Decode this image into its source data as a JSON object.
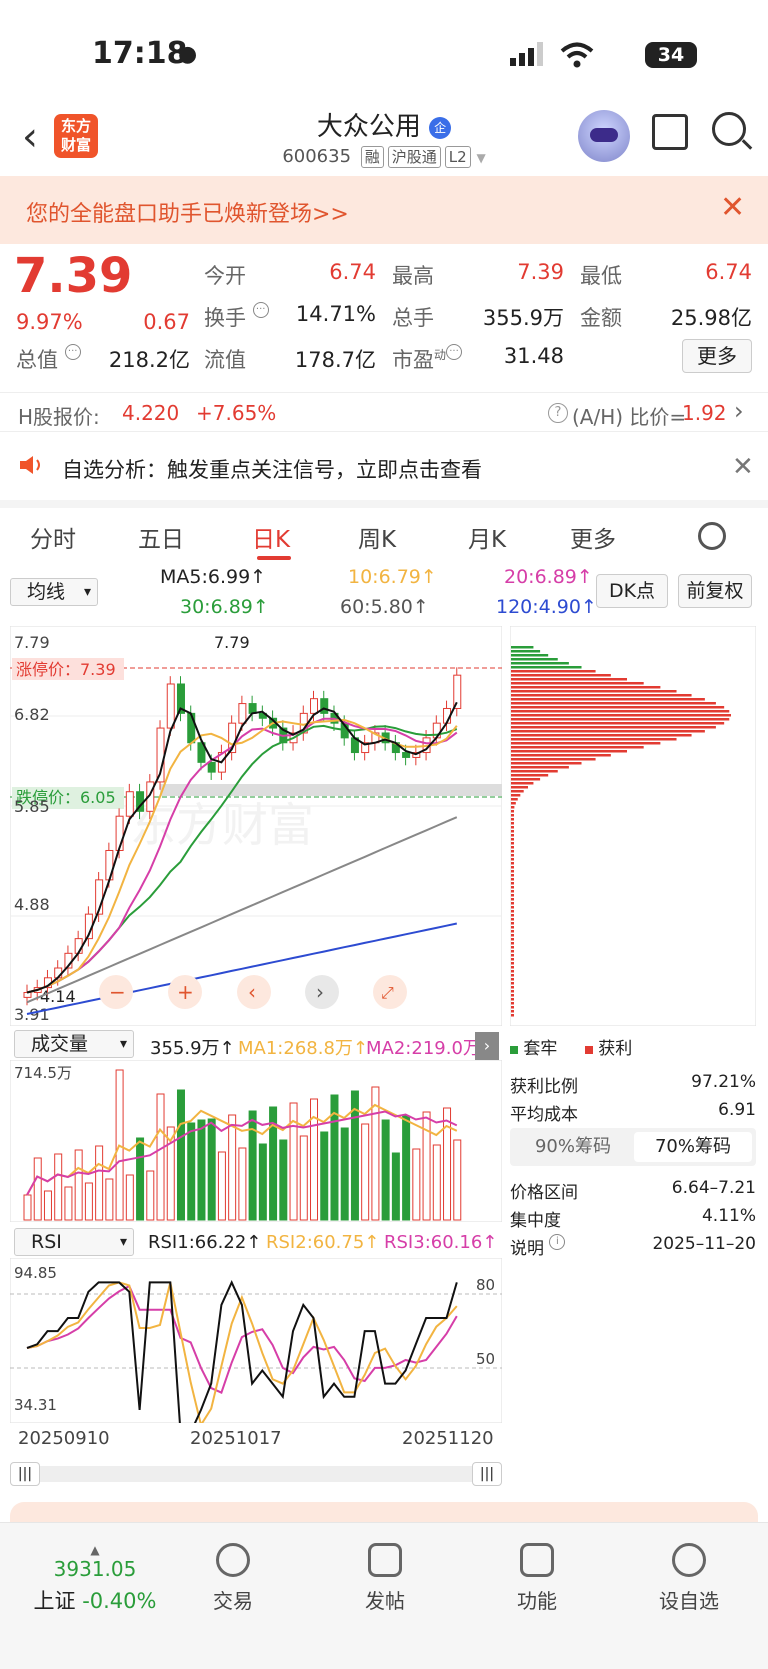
{
  "status": {
    "time": "17:18",
    "battery": "34"
  },
  "header": {
    "name": "大众公用",
    "qi": "企",
    "code": "600635",
    "tags": [
      "融",
      "沪股通",
      "L2"
    ],
    "logo": "东方财富"
  },
  "banner": {
    "text": "您的全能盘口助手已焕新登场>>"
  },
  "quote": {
    "price": "7.39",
    "change_pct": "9.97%",
    "change": "0.67",
    "open_label": "今开",
    "open": "6.74",
    "high_label": "最高",
    "high": "7.39",
    "low_label": "最低",
    "low": "6.74",
    "turnover_label": "换手",
    "turnover": "14.71%",
    "volume_label": "总手",
    "volume": "355.9万",
    "amount_label": "金额",
    "amount": "25.98亿",
    "mktcap_label": "总值",
    "mktcap": "218.2亿",
    "float_label": "流值",
    "float": "178.7亿",
    "pe_label": "市盈",
    "pe_sup": "动",
    "pe": "31.48",
    "more": "更多"
  },
  "hshare": {
    "label": "H股报价:",
    "price": "4.220",
    "change": "+7.65%",
    "ah_label": "(A/H) 比价=",
    "ah": "1.92"
  },
  "notice": {
    "text": "自选分析：触发重点关注信号，立即点击查看"
  },
  "tabs": [
    "分时",
    "五日",
    "日K",
    "周K",
    "月K",
    "更多"
  ],
  "ma": {
    "select": "均线",
    "ma5": "MA5:6.99↑",
    "ma10": "10:6.79↑",
    "ma20": "20:6.89↑",
    "ma30": "30:6.89↑",
    "ma60": "60:5.80↑",
    "ma120": "120:4.90↑",
    "dk": "DK点",
    "fq": "前复权"
  },
  "kchart": {
    "y_labels": [
      "7.79",
      "6.82",
      "5.85",
      "4.88",
      "3.91"
    ],
    "max_label": "7.79",
    "limit_up": "涨停价：7.39",
    "limit_down": "跌停价：6.05",
    "min_label": "4.14",
    "watermark": "东方财富"
  },
  "colors": {
    "up": "#e23b32",
    "down": "#2a9d3a",
    "ma5": "#111111",
    "ma10": "#f2b441",
    "ma20": "#d63ea8",
    "ma30": "#2a9d3a",
    "ma60": "#888888",
    "ma120": "#2d4bd1"
  },
  "vol": {
    "select": "成交量",
    "value": "355.9万↑",
    "ma1": "MA1:268.8万↑",
    "ma2": "MA2:219.0万↑",
    "max_label": "714.5万"
  },
  "rsi": {
    "select": "RSI",
    "rsi1": "RSI1:66.22↑",
    "rsi2": "RSI2:60.75↑",
    "rsi3": "RSI3:60.16↑",
    "top": "94.85",
    "bottom": "34.31",
    "l80": "80",
    "l50": "50"
  },
  "dates": [
    "20250910",
    "20251017",
    "20251120"
  ],
  "chips": {
    "legend_trap": "套牢",
    "legend_profit": "获利",
    "profit_ratio_label": "获利比例",
    "profit_ratio": "97.21%",
    "avg_cost_label": "平均成本",
    "avg_cost": "6.91",
    "seg90": "90%筹码",
    "seg70": "70%筹码",
    "range_label": "价格区间",
    "range": "6.64–7.21",
    "conc_label": "集中度",
    "conc": "4.11%",
    "note_label": "说明",
    "date": "2025–11–20"
  },
  "bottom": {
    "index_value": "3931.05",
    "index_name": "上证",
    "index_change": "-0.40%",
    "items": [
      "交易",
      "发帖",
      "功能",
      "设自选"
    ]
  }
}
